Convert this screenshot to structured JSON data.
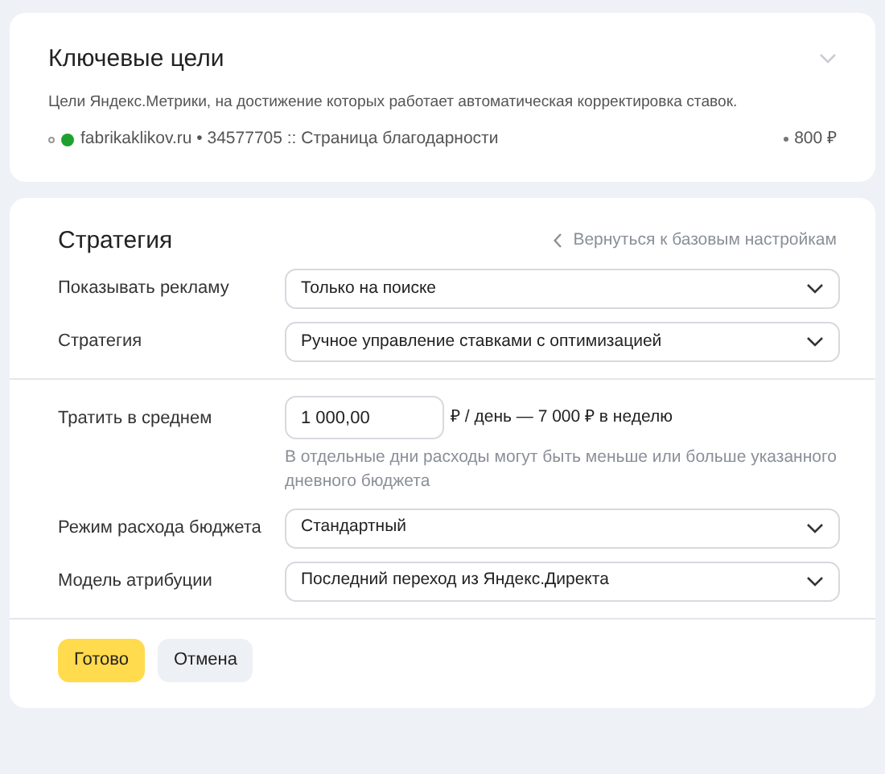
{
  "goals_card": {
    "title": "Ключевые цели",
    "expanded": false,
    "description": "Цели Яндекс.Метрики, на достижение которых работает автоматическая корректировка ставок.",
    "goals": [
      {
        "color": "#1fa12f",
        "name": "fabrikaklikov.ru • 34577705 :: Страница благодарности",
        "value": "800 ₽"
      }
    ]
  },
  "strategy_card": {
    "title": "Стратегия",
    "back_link": "Вернуться к базовым настройкам",
    "groups": [
      [
        {
          "kind": "select",
          "label": "Показывать рекламу",
          "value": "Только на поиске"
        },
        {
          "kind": "select",
          "label": "Стратегия",
          "value": "Ручное управление ставками с оптимизацией"
        }
      ],
      [
        {
          "kind": "amount",
          "label": "Тратить в среднем",
          "value": "1 000,00",
          "suffix": "₽ / день — 7 000 ₽ в неделю",
          "hint": "В отдельные дни расходы могут быть меньше или больше указанного дневного бюджета"
        },
        {
          "kind": "select",
          "label": "Режим расхода бюджета",
          "value": "Стандартный"
        },
        {
          "kind": "select",
          "label": "Модель атрибуции",
          "value": "Последний переход из Яндекс.Директа"
        }
      ]
    ],
    "buttons": [
      {
        "kind": "primary",
        "label": "Готово"
      },
      {
        "kind": "secondary",
        "label": "Отмена"
      }
    ]
  }
}
